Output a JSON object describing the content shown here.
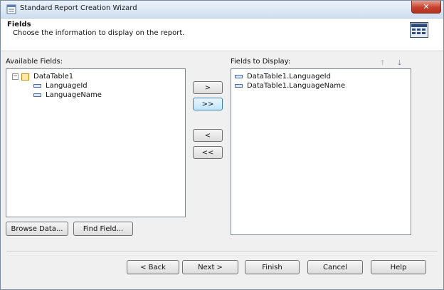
{
  "window": {
    "title": "Standard Report Creation Wizard",
    "close_glyph": "✕"
  },
  "header": {
    "title": "Fields",
    "subtitle": "Choose the information to display on the report."
  },
  "available": {
    "label": "Available Fields:",
    "table": {
      "name": "DataTable1",
      "expander": "−"
    },
    "fields": [
      "LanguageId",
      "LanguageName"
    ]
  },
  "display": {
    "label": "Fields to Display:",
    "fields": [
      "DataTable1.LanguageId",
      "DataTable1.LanguageName"
    ],
    "move_up_glyph": "🡑",
    "move_down_glyph": "🡓"
  },
  "transfer": {
    "add": ">",
    "add_all": ">>",
    "remove": "<",
    "remove_all": "<<"
  },
  "lower_buttons": {
    "browse": "Browse Data...",
    "find": "Find Field..."
  },
  "footer": {
    "back": "< Back",
    "next": "Next >",
    "finish": "Finish",
    "cancel": "Cancel",
    "help": "Help"
  },
  "colors": {
    "accent": "#3c7fb1",
    "close": "#c6412d",
    "panel": "#f0f0f0"
  }
}
